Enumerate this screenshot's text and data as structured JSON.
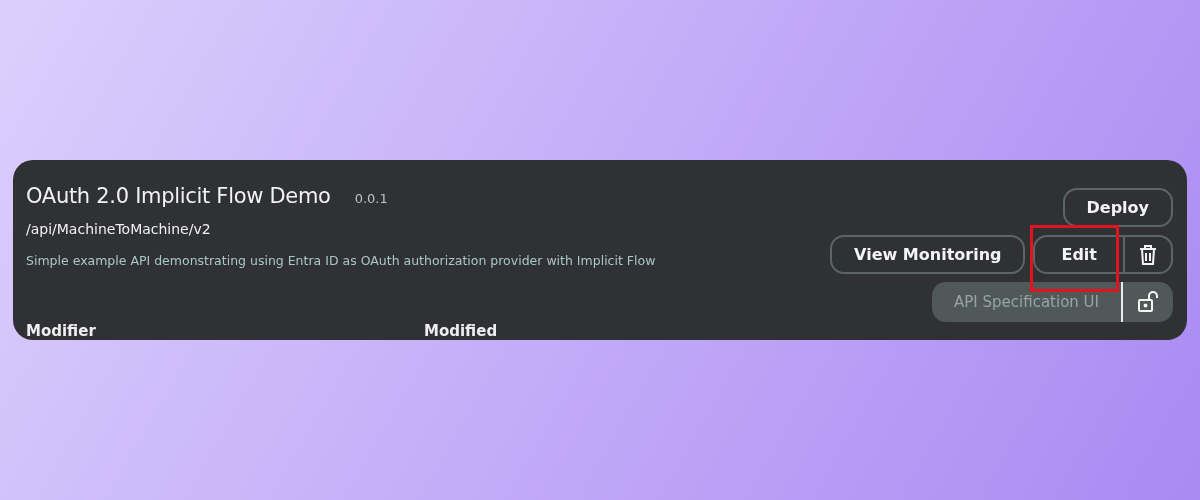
{
  "api": {
    "title": "OAuth 2.0 Implicit Flow Demo",
    "version": "0.0.1",
    "path": "/api/MachineToMachine/v2",
    "description": "Simple example API demonstrating using Entra ID as OAuth authorization provider with Implicit Flow"
  },
  "fields": [
    {
      "label": "Modifier"
    },
    {
      "label": "Modified"
    }
  ],
  "actions": {
    "deploy": {
      "label": "Deploy"
    },
    "monitoring": {
      "label": "View Monitoring"
    },
    "edit": {
      "label": "Edit",
      "highlighted": true
    },
    "spec": {
      "label": "API Specification UI",
      "disabled": true
    }
  }
}
